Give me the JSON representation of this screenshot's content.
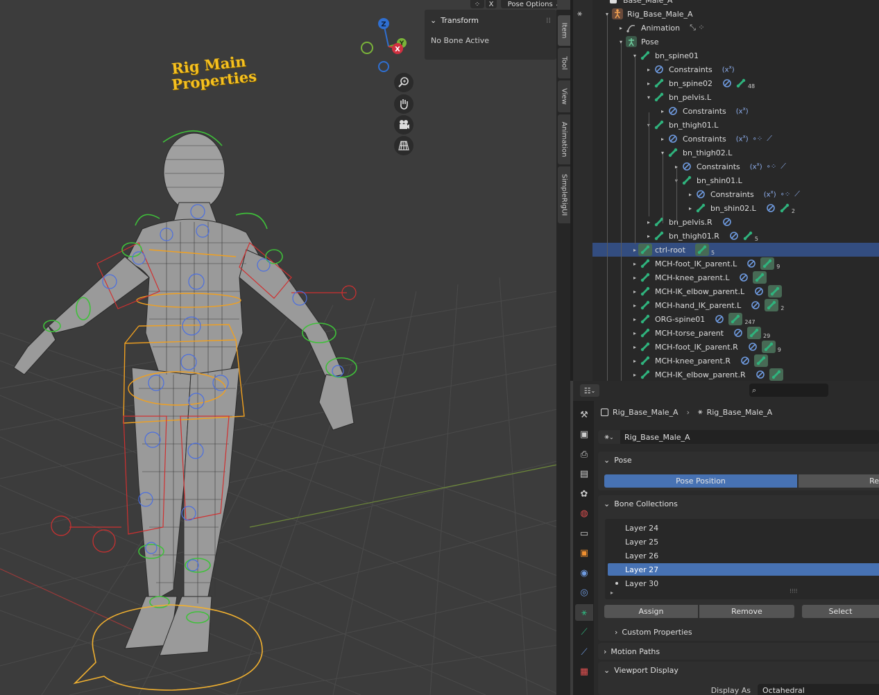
{
  "viewport": {
    "rig_title_line1": "Rig Main",
    "rig_title_line2": "Properties",
    "pose_options_label": "Pose Options",
    "close_label": "X",
    "gizmo": {
      "z": "Z",
      "y": "Y",
      "x": "X"
    },
    "nav_buttons": [
      "zoom-icon",
      "pan-hand-icon",
      "camera-icon",
      "grid-perspective-icon"
    ]
  },
  "sidebar": {
    "panel_title": "Transform",
    "panel_body": "No Bone Active",
    "tabs": [
      "Item",
      "Tool",
      "View",
      "Animation",
      "SimpleRigUI"
    ]
  },
  "outliner": {
    "top_partial": "Base_Male_A",
    "rows": [
      {
        "label": "Rig_Base_Male_A",
        "icon": "armature-icon"
      },
      {
        "label": "Animation",
        "icon": "animation-icon"
      },
      {
        "label": "Pose",
        "icon": "pose-icon"
      },
      {
        "label": "bn_spine01",
        "icon": "bone-icon"
      },
      {
        "label": "Constraints",
        "icon": "constraint-icon"
      },
      {
        "label": "bn_spine02",
        "icon": "bone-icon",
        "count": "48"
      },
      {
        "label": "bn_pelvis.L",
        "icon": "bone-icon"
      },
      {
        "label": "Constraints",
        "icon": "constraint-icon"
      },
      {
        "label": "bn_thigh01.L",
        "icon": "bone-icon"
      },
      {
        "label": "Constraints",
        "icon": "constraint-icon"
      },
      {
        "label": "bn_thigh02.L",
        "icon": "bone-icon"
      },
      {
        "label": "Constraints",
        "icon": "constraint-icon"
      },
      {
        "label": "bn_shin01.L",
        "icon": "bone-icon"
      },
      {
        "label": "Constraints",
        "icon": "constraint-icon"
      },
      {
        "label": "bn_shin02.L",
        "icon": "bone-icon",
        "count": "2"
      },
      {
        "label": "bn_pelvis.R",
        "icon": "bone-icon"
      },
      {
        "label": "bn_thigh01.R",
        "icon": "bone-icon",
        "count": "5"
      },
      {
        "label": "ctrl-root",
        "icon": "bone-icon",
        "count": "5"
      },
      {
        "label": "MCH-foot_IK_parent.L",
        "icon": "bone-icon",
        "count": "9"
      },
      {
        "label": "MCH-knee_parent.L",
        "icon": "bone-icon"
      },
      {
        "label": "MCH-IK_elbow_parent.L",
        "icon": "bone-icon"
      },
      {
        "label": "MCH-hand_IK_parent.L",
        "icon": "bone-icon",
        "count": "2"
      },
      {
        "label": "ORG-spine01",
        "icon": "bone-icon",
        "count": "247"
      },
      {
        "label": "MCH-torse_parent",
        "icon": "bone-icon",
        "count": "29"
      },
      {
        "label": "MCH-foot_IK_parent.R",
        "icon": "bone-icon",
        "count": "9"
      },
      {
        "label": "MCH-knee_parent.R",
        "icon": "bone-icon"
      },
      {
        "label": "MCH-IK_elbow_parent.R",
        "icon": "bone-icon"
      }
    ]
  },
  "properties": {
    "breadcrumb": [
      "Rig_Base_Male_A",
      "Rig_Base_Male_A"
    ],
    "data_name": "Rig_Base_Male_A",
    "pose_panel": "Pose",
    "pose_position": "Pose Position",
    "rest_position_partial": "Re",
    "bone_collections_panel": "Bone Collections",
    "layers": [
      "Layer 24",
      "Layer 25",
      "Layer 26",
      "Layer 27",
      "Layer 30"
    ],
    "selected_layer": "Layer 27",
    "assign": "Assign",
    "remove": "Remove",
    "select": "Select",
    "custom_properties": "Custom Properties",
    "motion_paths": "Motion Paths",
    "viewport_display": "Viewport Display",
    "display_as_label": "Display As",
    "display_as_value": "Octahedral"
  },
  "colors": {
    "accent": "#4772b3",
    "bone_green": "#2fb37d",
    "constraint_blue": "#6f9be0",
    "rig_title": "#f5c020"
  }
}
